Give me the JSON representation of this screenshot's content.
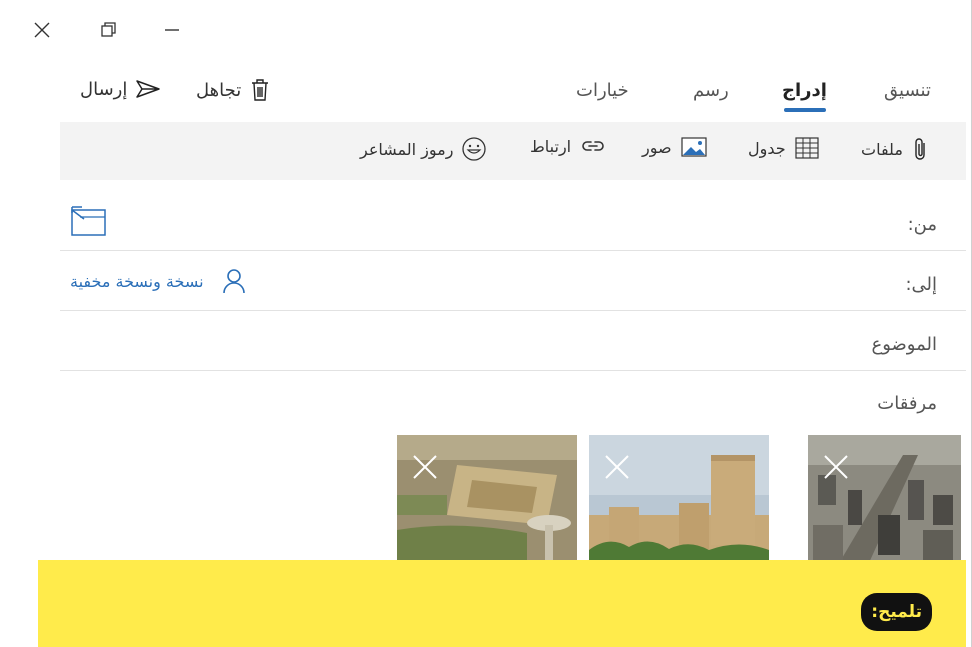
{
  "window": {
    "close_icon": "close-icon",
    "restore_icon": "restore-icon",
    "minimize_icon": "minimize-icon"
  },
  "commands": {
    "send_label": "إرسال",
    "discard_label": "تجاهل"
  },
  "tabs": [
    {
      "label": "تنسيق"
    },
    {
      "label": "إدراج",
      "active": true
    },
    {
      "label": "رسم"
    },
    {
      "label": "خيارات"
    }
  ],
  "toolbar": {
    "files": "ملفات",
    "table": "جدول",
    "pictures": "صور",
    "link": "ارتباط",
    "emoji": "رموز المشاعر"
  },
  "compose": {
    "from_label": "من:",
    "to_label": "إلى:",
    "cc_bcc": "نسخة ونسخة مخفية",
    "subject_placeholder": "الموضوع",
    "attachments_label": "مرفقات"
  },
  "tip": {
    "badge": "تلميح:"
  },
  "colors": {
    "accent": "#2b6fb8",
    "tip_background": "#ffeb4b",
    "toolbar_background": "#f3f3f3"
  }
}
